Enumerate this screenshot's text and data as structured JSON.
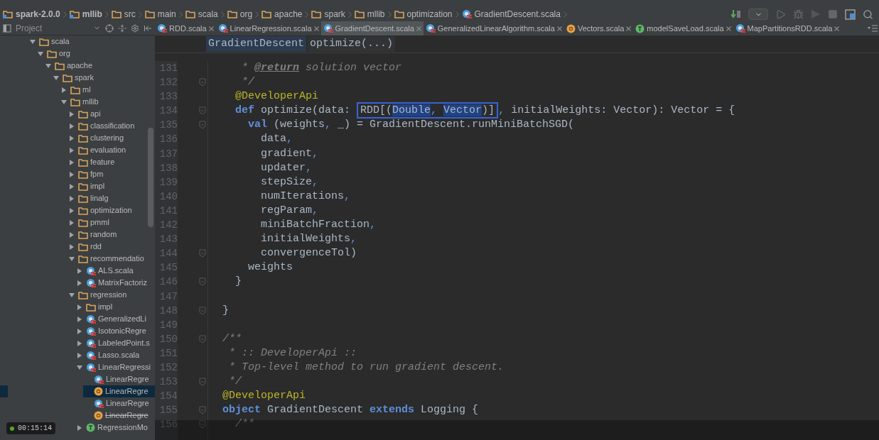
{
  "breadcrumbs": [
    {
      "label": "spark-2.0.0",
      "kind": "module"
    },
    {
      "label": "mllib",
      "kind": "module"
    },
    {
      "label": "src",
      "kind": "folder"
    },
    {
      "label": "main",
      "kind": "folder"
    },
    {
      "label": "scala",
      "kind": "folder"
    },
    {
      "label": "org",
      "kind": "folder"
    },
    {
      "label": "apache",
      "kind": "folder"
    },
    {
      "label": "spark",
      "kind": "folder"
    },
    {
      "label": "mllib",
      "kind": "folder"
    },
    {
      "label": "optimization",
      "kind": "folder"
    },
    {
      "label": "GradientDescent.scala",
      "kind": "class"
    }
  ],
  "tabs": [
    {
      "label": "RDD.scala",
      "kind": "class",
      "selected": false
    },
    {
      "label": "LinearRegression.scala",
      "kind": "class",
      "selected": false
    },
    {
      "label": "GradientDescent.scala",
      "kind": "class",
      "selected": true
    },
    {
      "label": "GeneralizedLinearAlgorithm.scala",
      "kind": "class",
      "selected": false
    },
    {
      "label": "Vectors.scala",
      "kind": "object",
      "selected": false
    },
    {
      "label": "modelSaveLoad.scala",
      "kind": "trait",
      "selected": false
    },
    {
      "label": "MapPartitionsRDD.scala",
      "kind": "class",
      "selected": false
    }
  ],
  "sidebar": {
    "title": "Project",
    "tree": [
      {
        "label": "scala",
        "kind": "folder",
        "expanded": true,
        "selected": false,
        "children": [
          {
            "label": "org",
            "kind": "folder",
            "expanded": true,
            "selected": false,
            "children": [
              {
                "label": "apache",
                "kind": "folder",
                "expanded": true,
                "selected": false,
                "children": [
                  {
                    "label": "spark",
                    "kind": "folder",
                    "expanded": true,
                    "selected": false,
                    "children": [
                      {
                        "label": "ml",
                        "kind": "folder",
                        "expanded": false,
                        "selected": false
                      },
                      {
                        "label": "mllib",
                        "kind": "folder",
                        "expanded": true,
                        "selected": false,
                        "children": [
                          {
                            "label": "api",
                            "kind": "folder",
                            "expanded": false,
                            "selected": false
                          },
                          {
                            "label": "classification",
                            "kind": "folder",
                            "expanded": false,
                            "selected": false
                          },
                          {
                            "label": "clustering",
                            "kind": "folder",
                            "expanded": false,
                            "selected": false
                          },
                          {
                            "label": "evaluation",
                            "kind": "folder",
                            "expanded": false,
                            "selected": false
                          },
                          {
                            "label": "feature",
                            "kind": "folder",
                            "expanded": false,
                            "selected": false
                          },
                          {
                            "label": "fpm",
                            "kind": "folder",
                            "expanded": false,
                            "selected": false
                          },
                          {
                            "label": "impl",
                            "kind": "folder",
                            "expanded": false,
                            "selected": false
                          },
                          {
                            "label": "linalg",
                            "kind": "folder",
                            "expanded": false,
                            "selected": false
                          },
                          {
                            "label": "optimization",
                            "kind": "folder",
                            "expanded": false,
                            "selected": false
                          },
                          {
                            "label": "pmml",
                            "kind": "folder",
                            "expanded": false,
                            "selected": false
                          },
                          {
                            "label": "random",
                            "kind": "folder",
                            "expanded": false,
                            "selected": false
                          },
                          {
                            "label": "rdd",
                            "kind": "folder",
                            "expanded": false,
                            "selected": false
                          },
                          {
                            "label": "recommendatio",
                            "kind": "folder",
                            "expanded": true,
                            "selected": false,
                            "children": [
                              {
                                "label": "ALS.scala",
                                "kind": "class",
                                "expanded": false,
                                "selected": false
                              },
                              {
                                "label": "MatrixFactoriz",
                                "kind": "class",
                                "expanded": false,
                                "selected": false
                              }
                            ]
                          },
                          {
                            "label": "regression",
                            "kind": "folder",
                            "expanded": true,
                            "selected": false,
                            "children": [
                              {
                                "label": "impl",
                                "kind": "folder",
                                "expanded": false,
                                "selected": false
                              },
                              {
                                "label": "GeneralizedLi",
                                "kind": "class",
                                "expanded": false,
                                "selected": false
                              },
                              {
                                "label": "IsotonicRegre",
                                "kind": "class",
                                "expanded": false,
                                "selected": false
                              },
                              {
                                "label": "LabeledPoint.s",
                                "kind": "class",
                                "expanded": false,
                                "selected": false
                              },
                              {
                                "label": "Lasso.scala",
                                "kind": "class",
                                "expanded": false,
                                "selected": false
                              },
                              {
                                "label": "LinearRegressi",
                                "kind": "class",
                                "expanded": true,
                                "selected": false,
                                "children": [
                                  {
                                    "label": "LinearRegre",
                                    "kind": "class",
                                    "selected": false,
                                    "deprecated": false
                                  },
                                  {
                                    "label": "LinearRegre",
                                    "kind": "object",
                                    "selected": true,
                                    "deprecated": false
                                  },
                                  {
                                    "label": "LinearRegre",
                                    "kind": "class",
                                    "selected": false,
                                    "deprecated": false
                                  },
                                  {
                                    "label": "LinearRegre",
                                    "kind": "object",
                                    "selected": false,
                                    "deprecated": true
                                  }
                                ]
                              },
                              {
                                "label": "RegressionMo",
                                "kind": "trait",
                                "expanded": false,
                                "selected": false
                              }
                            ]
                          }
                        ]
                      }
                    ]
                  }
                ]
              }
            ]
          }
        ]
      }
    ]
  },
  "editor": {
    "path": [
      "GradientDescent",
      "optimize(...)"
    ],
    "lines": [
      {
        "number": "131",
        "fold": false,
        "tokens": [
          {
            "kind": "comment",
            "text": "   * "
          },
          {
            "kind": "doctag",
            "text": "@return"
          },
          {
            "kind": "comment",
            "text": " solution vector"
          }
        ]
      },
      {
        "number": "132",
        "fold": true,
        "tokens": [
          {
            "kind": "comment",
            "text": "   */"
          }
        ]
      },
      {
        "number": "133",
        "fold": false,
        "tokens": [
          {
            "kind": "annotation",
            "text": "  @DeveloperApi"
          }
        ]
      },
      {
        "number": "134",
        "fold": true,
        "tokens": [
          {
            "kind": "keyword",
            "text": "  def"
          },
          {
            "kind": "plain",
            "text": " optimize(data: "
          },
          {
            "kind": "plain",
            "text": "RDD[(",
            "framed": true
          },
          {
            "kind": "selected",
            "text": "Double",
            "framed": true
          },
          {
            "kind": "punct",
            "text": ", ",
            "framed": true
          },
          {
            "kind": "selected",
            "text": "Vector",
            "framed": true
          },
          {
            "kind": "plain",
            "text": ")]",
            "framed": true
          },
          {
            "kind": "punct",
            "text": ","
          },
          {
            "kind": "plain",
            "text": " initialWeights: Vector): Vector = {"
          }
        ]
      },
      {
        "number": "135",
        "fold": true,
        "tokens": [
          {
            "kind": "keyword",
            "text": "    val"
          },
          {
            "kind": "plain",
            "text": " (weights"
          },
          {
            "kind": "punct",
            "text": ","
          },
          {
            "kind": "plain",
            "text": " _) = GradientDescent.runMiniBatchSGD("
          }
        ]
      },
      {
        "number": "136",
        "fold": false,
        "tokens": [
          {
            "kind": "plain",
            "text": "      data"
          },
          {
            "kind": "punct",
            "text": ","
          }
        ]
      },
      {
        "number": "137",
        "fold": false,
        "tokens": [
          {
            "kind": "plain",
            "text": "      gradient"
          },
          {
            "kind": "punct",
            "text": ","
          }
        ]
      },
      {
        "number": "138",
        "fold": false,
        "tokens": [
          {
            "kind": "plain",
            "text": "      updater"
          },
          {
            "kind": "punct",
            "text": ","
          }
        ]
      },
      {
        "number": "139",
        "fold": false,
        "tokens": [
          {
            "kind": "plain",
            "text": "      stepSize"
          },
          {
            "kind": "punct",
            "text": ","
          }
        ]
      },
      {
        "number": "140",
        "fold": false,
        "tokens": [
          {
            "kind": "plain",
            "text": "      numIterations"
          },
          {
            "kind": "punct",
            "text": ","
          }
        ]
      },
      {
        "number": "141",
        "fold": false,
        "tokens": [
          {
            "kind": "plain",
            "text": "      regParam"
          },
          {
            "kind": "punct",
            "text": ","
          }
        ]
      },
      {
        "number": "142",
        "fold": false,
        "tokens": [
          {
            "kind": "plain",
            "text": "      miniBatchFraction"
          },
          {
            "kind": "punct",
            "text": ","
          }
        ]
      },
      {
        "number": "143",
        "fold": false,
        "tokens": [
          {
            "kind": "plain",
            "text": "      initialWeights"
          },
          {
            "kind": "punct",
            "text": ","
          }
        ]
      },
      {
        "number": "144",
        "fold": true,
        "tokens": [
          {
            "kind": "plain",
            "text": "      convergenceTol)"
          }
        ]
      },
      {
        "number": "145",
        "fold": false,
        "tokens": [
          {
            "kind": "plain",
            "text": "    weights"
          }
        ]
      },
      {
        "number": "146",
        "fold": true,
        "tokens": [
          {
            "kind": "plain",
            "text": "  }"
          }
        ]
      },
      {
        "number": "147",
        "fold": false
      },
      {
        "number": "148",
        "fold": true,
        "tokens": [
          {
            "kind": "plain",
            "text": "}"
          }
        ]
      },
      {
        "number": "149",
        "fold": false
      },
      {
        "number": "150",
        "fold": true,
        "tokens": [
          {
            "kind": "comment",
            "text": "/**"
          }
        ]
      },
      {
        "number": "151",
        "fold": false,
        "tokens": [
          {
            "kind": "comment",
            "text": " * :: DeveloperApi ::"
          }
        ]
      },
      {
        "number": "152",
        "fold": false,
        "tokens": [
          {
            "kind": "comment",
            "text": " * Top-level method to run gradient descent."
          }
        ]
      },
      {
        "number": "153",
        "fold": true,
        "tokens": [
          {
            "kind": "comment",
            "text": " */"
          }
        ]
      },
      {
        "number": "154",
        "fold": false,
        "tokens": [
          {
            "kind": "annotation",
            "text": "@DeveloperApi"
          }
        ]
      },
      {
        "number": "155",
        "fold": true,
        "tokens": [
          {
            "kind": "keyword",
            "text": "object"
          },
          {
            "kind": "plain",
            "text": " GradientDescent "
          },
          {
            "kind": "keyword",
            "text": "extends"
          },
          {
            "kind": "plain",
            "text": " Logging {"
          }
        ]
      },
      {
        "number": "156",
        "fold": true,
        "tokens": [
          {
            "kind": "comment",
            "text": "  /**"
          }
        ]
      }
    ]
  },
  "recording_timer": "00:15:14"
}
